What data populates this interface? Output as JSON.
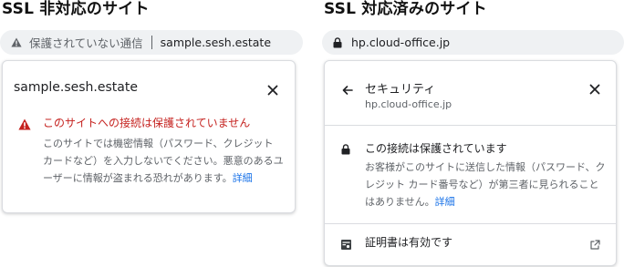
{
  "left": {
    "heading": "SSL 非対応のサイト",
    "address_status": "保護されていない通信",
    "address_url": "sample.sesh.estate",
    "panel": {
      "host": "sample.sesh.estate",
      "warning_title": "このサイトへの接続は保護されていません",
      "warning_body": "このサイトでは機密情報（パスワード、クレジット カードなど）を入力しないでください。悪意のあるユーザーに情報が盗まれる恐れがあります。",
      "details_link": "詳細"
    }
  },
  "right": {
    "heading": "SSL 対応済みのサイト",
    "address_url": "hp.cloud-office.jp",
    "panel": {
      "title": "セキュリティ",
      "host": "hp.cloud-office.jp",
      "connection_title": "この接続は保護されています",
      "connection_body": "お客様がこのサイトに送信した情報（パスワード、クレジット カード番号など）が第三者に見られることはありません。",
      "details_link": "詳細",
      "certificate_label": "証明書は有効です"
    }
  },
  "colors": {
    "warning_red": "#c5221f",
    "link_blue": "#1a73e8",
    "address_bar_bg": "#eff1f3"
  },
  "icons": [
    "warning-icon",
    "lock-icon",
    "close-icon",
    "back-arrow-icon",
    "certificate-icon",
    "external-link-icon"
  ]
}
